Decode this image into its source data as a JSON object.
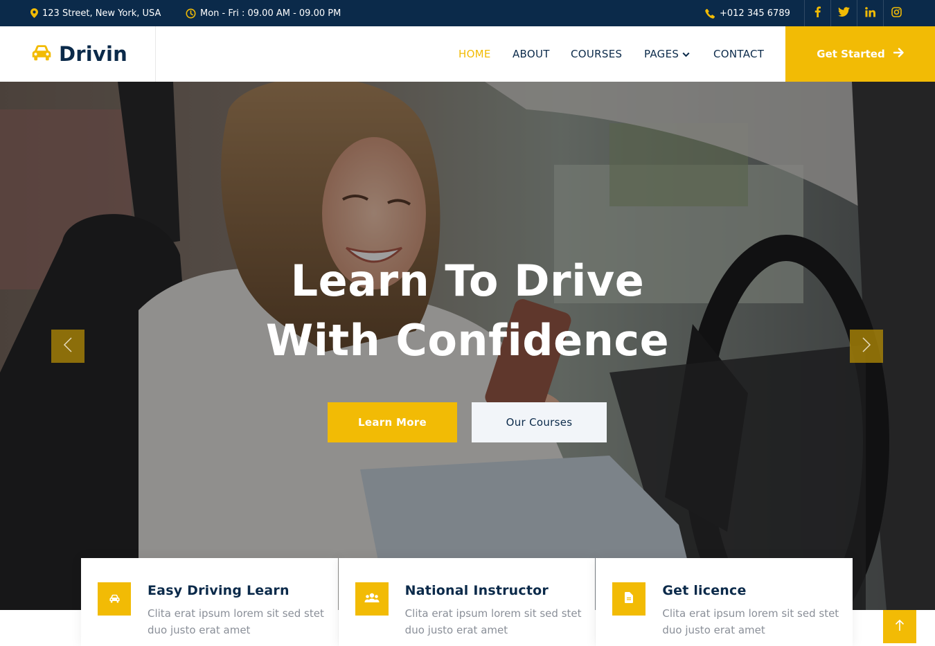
{
  "topbar": {
    "address": "123 Street, New York, USA",
    "hours": "Mon - Fri : 09.00 AM - 09.00 PM",
    "phone": "+012 345 6789",
    "social": [
      "facebook-icon",
      "twitter-icon",
      "linkedin-icon",
      "instagram-icon"
    ]
  },
  "brand": {
    "name": "Drivin",
    "icon": "car-icon"
  },
  "nav": {
    "home": "HOME",
    "about": "ABOUT",
    "courses": "COURSES",
    "pages": "PAGES",
    "contact": "CONTACT",
    "cta": "Get Started"
  },
  "hero": {
    "title_line1": "Learn To Drive",
    "title_line2": "With Confidence",
    "btn_primary": "Learn More",
    "btn_secondary": "Our Courses"
  },
  "features": [
    {
      "icon": "car-icon",
      "title": "Easy Driving Learn",
      "text": "Clita erat ipsum lorem sit sed stet duo justo erat amet"
    },
    {
      "icon": "users-icon",
      "title": "National Instructor",
      "text": "Clita erat ipsum lorem sit sed stet duo justo erat amet"
    },
    {
      "icon": "file-icon",
      "title": "Get licence",
      "text": "Clita erat ipsum lorem sit sed stet duo justo erat amet"
    }
  ],
  "colors": {
    "navy": "#0b2a4a",
    "accent": "#f2bb05",
    "muted": "#8a8f98"
  }
}
